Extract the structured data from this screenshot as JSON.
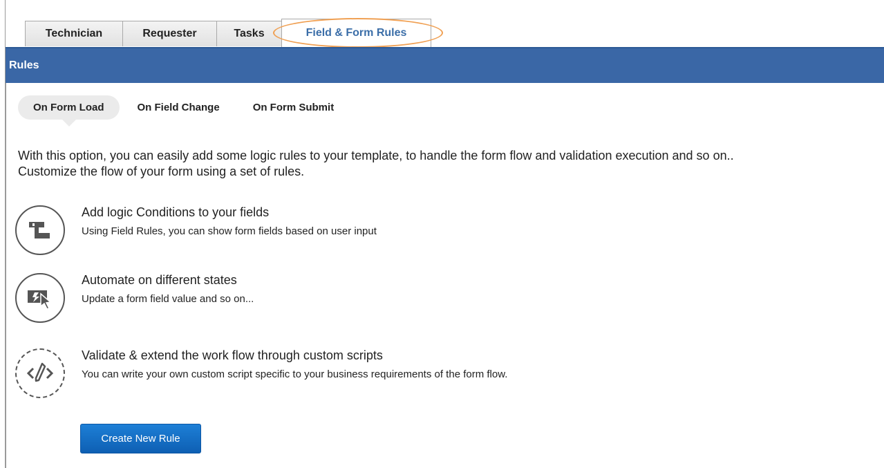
{
  "tabs": [
    {
      "label": "Technician"
    },
    {
      "label": "Requester"
    },
    {
      "label": "Tasks"
    },
    {
      "label": "Field & Form Rules"
    }
  ],
  "header": {
    "title": "Rules"
  },
  "subtabs": [
    {
      "label": "On Form Load"
    },
    {
      "label": "On Field Change"
    },
    {
      "label": "On Form Submit"
    }
  ],
  "intro": {
    "line1": "With this option, you can easily add some logic rules to your template, to handle the form flow and validation execution and so on..",
    "line2": "Customize the flow of your form using a set of rules."
  },
  "features": [
    {
      "title": "Add logic Conditions to your fields",
      "desc": "Using Field Rules, you can show form fields based on user input",
      "icon": "logic-flow-icon"
    },
    {
      "title": "Automate on different states",
      "desc": "Update a form field value and so on...",
      "icon": "automate-click-icon"
    },
    {
      "title": "Validate & extend the work flow through custom scripts",
      "desc": "You can write your own custom script specific to your business requirements of the form flow.",
      "icon": "code-script-icon"
    }
  ],
  "actions": {
    "create_label": "Create New Rule"
  },
  "colors": {
    "header_bar": "#3a67a6",
    "active_tab_text": "#3b6ea8",
    "highlight_ring": "#f0a053",
    "button": "#1470c8"
  }
}
